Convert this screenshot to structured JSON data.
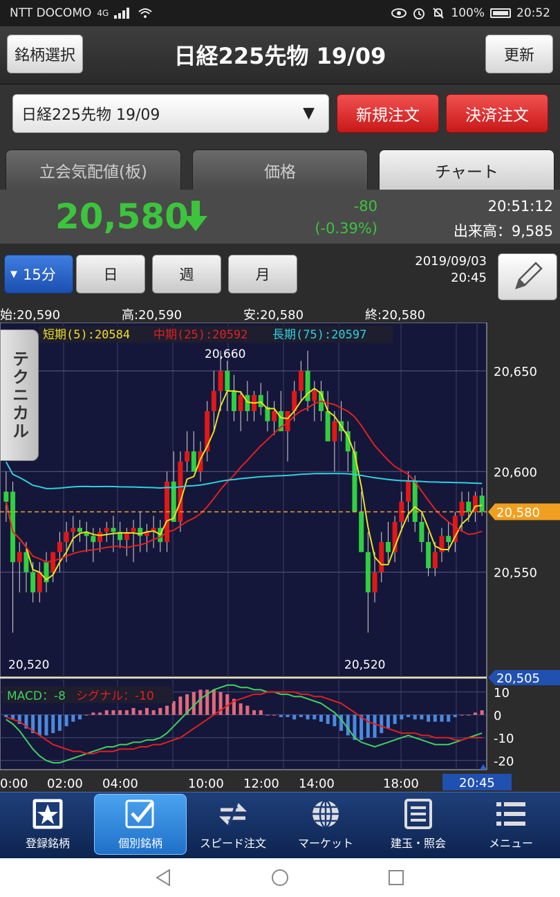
{
  "status": {
    "carrier": "NTT DOCOMO",
    "signal": "4G",
    "battery": "100%",
    "clock": "20:52"
  },
  "header": {
    "left_button": "銘柄選択",
    "title": "日経225先物 19/09",
    "right_button": "更新"
  },
  "selector": {
    "selected": "日経225先物 19/09",
    "new_order": "新規注文",
    "settle_order": "決済注文"
  },
  "tabs": [
    {
      "label": "立会気配値(板)",
      "active": false
    },
    {
      "label": "価格",
      "active": false
    },
    {
      "label": "チャート",
      "active": true
    }
  ],
  "quote": {
    "price": "20,580",
    "change": "-80",
    "change_pct": "(-0.39%)",
    "time": "20:51:12",
    "volume": "出来高：9,585",
    "color_down": "#3cc43c"
  },
  "periods": {
    "items": [
      {
        "label": "15分",
        "active": true
      },
      {
        "label": "日",
        "active": false
      },
      {
        "label": "週",
        "active": false
      },
      {
        "label": "月",
        "active": false
      }
    ],
    "date": "2019/09/03",
    "time": "20:45"
  },
  "ohlc": {
    "open": "始:20,590",
    "high": "高:20,590",
    "low": "安:20,580",
    "close": "終:20,580"
  },
  "technical_tab": "テクニカル",
  "chart_data": {
    "type": "candlestick",
    "ma_legend": [
      {
        "label": "短期(5):20584",
        "color": "#f0e020"
      },
      {
        "label": "中期(25):20592",
        "color": "#e02020"
      },
      {
        "label": "長期(75):20597",
        "color": "#30d0e0"
      }
    ],
    "ylim": [
      20498,
      20674
    ],
    "y_ticks": [
      "20,650",
      "20,600",
      "20,550"
    ],
    "y_tick_values": [
      20650,
      20600,
      20550
    ],
    "current_price_label": "20,580",
    "current_price": 20580,
    "lower_marker_label": "20,505",
    "lower_marker": 20505,
    "max_label": "20,660",
    "min_label_left": "20,520",
    "min_label_right": "20,520",
    "x_labels": [
      "0:00",
      "02:00",
      "04:00",
      "10:00",
      "12:00",
      "14:00",
      "18:00",
      "20:45"
    ],
    "candles": [
      [
        20590,
        20600,
        20575,
        20585
      ],
      [
        20590,
        20595,
        20520,
        20555
      ],
      [
        20555,
        20565,
        20540,
        20560
      ],
      [
        20560,
        20565,
        20540,
        20550
      ],
      [
        20550,
        20555,
        20535,
        20540
      ],
      [
        20540,
        20555,
        20535,
        20550
      ],
      [
        20555,
        20560,
        20540,
        20545
      ],
      [
        20550,
        20560,
        20545,
        20560
      ],
      [
        20560,
        20570,
        20550,
        20565
      ],
      [
        20565,
        20575,
        20555,
        20570
      ],
      [
        20570,
        20578,
        20560,
        20572
      ],
      [
        20572,
        20576,
        20565,
        20570
      ],
      [
        20570,
        20575,
        20560,
        20568
      ],
      [
        20568,
        20572,
        20555,
        20565
      ],
      [
        20565,
        20572,
        20560,
        20570
      ],
      [
        20570,
        20575,
        20565,
        20572
      ],
      [
        20572,
        20578,
        20560,
        20570
      ],
      [
        20570,
        20575,
        20562,
        20566
      ],
      [
        20566,
        20572,
        20558,
        20570
      ],
      [
        20570,
        20576,
        20555,
        20572
      ],
      [
        20572,
        20580,
        20560,
        20568
      ],
      [
        20568,
        20574,
        20560,
        20570
      ],
      [
        20570,
        20578,
        20562,
        20572
      ],
      [
        20572,
        20576,
        20560,
        20565
      ],
      [
        20565,
        20600,
        20560,
        20595
      ],
      [
        20595,
        20610,
        20590,
        20575
      ],
      [
        20575,
        20610,
        20570,
        20605
      ],
      [
        20605,
        20620,
        20600,
        20610
      ],
      [
        20610,
        20620,
        20600,
        20600
      ],
      [
        20600,
        20615,
        20595,
        20610
      ],
      [
        20610,
        20635,
        20605,
        20630
      ],
      [
        20630,
        20650,
        20620,
        20640
      ],
      [
        20640,
        20660,
        20630,
        20650
      ],
      [
        20650,
        20655,
        20630,
        20640
      ],
      [
        20640,
        20648,
        20625,
        20630
      ],
      [
        20630,
        20640,
        20620,
        20638
      ],
      [
        20638,
        20645,
        20625,
        20630
      ],
      [
        20630,
        20640,
        20625,
        20638
      ],
      [
        20638,
        20644,
        20628,
        20632
      ],
      [
        20632,
        20640,
        20620,
        20625
      ],
      [
        20625,
        20635,
        20618,
        20630
      ],
      [
        20630,
        20640,
        20625,
        20620
      ],
      [
        20620,
        20625,
        20605,
        20630
      ],
      [
        20630,
        20645,
        20625,
        20640
      ],
      [
        20640,
        20655,
        20635,
        20650
      ],
      [
        20650,
        20660,
        20630,
        20635
      ],
      [
        20635,
        20645,
        20625,
        20640
      ],
      [
        20640,
        20645,
        20625,
        20630
      ],
      [
        20630,
        20640,
        20620,
        20615
      ],
      [
        20615,
        20630,
        20600,
        20625
      ],
      [
        20625,
        20635,
        20615,
        20620
      ],
      [
        20620,
        20625,
        20600,
        20610
      ],
      [
        20610,
        20615,
        20590,
        20580
      ],
      [
        20580,
        20590,
        20560,
        20560
      ],
      [
        20560,
        20570,
        20520,
        20540
      ],
      [
        20540,
        20560,
        20535,
        20550
      ],
      [
        20550,
        20570,
        20545,
        20565
      ],
      [
        20565,
        20575,
        20555,
        20560
      ],
      [
        20560,
        20578,
        20555,
        20575
      ],
      [
        20575,
        20590,
        20570,
        20585
      ],
      [
        20585,
        20600,
        20575,
        20595
      ],
      [
        20595,
        20598,
        20570,
        20575
      ],
      [
        20575,
        20580,
        20560,
        20565
      ],
      [
        20565,
        20570,
        20548,
        20552
      ],
      [
        20552,
        20565,
        20548,
        20560
      ],
      [
        20560,
        20572,
        20555,
        20568
      ],
      [
        20568,
        20575,
        20560,
        20565
      ],
      [
        20565,
        20580,
        20560,
        20578
      ],
      [
        20578,
        20590,
        20570,
        20585
      ],
      [
        20585,
        20590,
        20575,
        20580
      ],
      [
        20580,
        20590,
        20575,
        20588
      ],
      [
        20588,
        20592,
        20578,
        20580
      ]
    ],
    "macd": {
      "legend_macd": "MACD：-8",
      "legend_signal": "シグナル：-10",
      "ylim": [
        -24,
        16
      ],
      "y_ticks": [
        "10",
        "0",
        "-10",
        "-20"
      ],
      "y_tick_values": [
        10,
        0,
        -10,
        -20
      ],
      "macd_color": "#40d060",
      "signal_color": "#e02020",
      "macd": [
        -2,
        -4,
        -7,
        -11,
        -15,
        -18,
        -20,
        -21,
        -21,
        -20,
        -19,
        -18,
        -17,
        -16,
        -15,
        -14,
        -14,
        -13,
        -13,
        -12,
        -12,
        -11,
        -11,
        -10,
        -8,
        -5,
        -2,
        1,
        4,
        7,
        9,
        11,
        12,
        13,
        13,
        12,
        12,
        11,
        11,
        10,
        10,
        9,
        9,
        8,
        8,
        7,
        6,
        5,
        3,
        1,
        -2,
        -6,
        -10,
        -12,
        -13,
        -14,
        -13,
        -12,
        -11,
        -10,
        -9,
        -10,
        -11,
        -12,
        -13,
        -13,
        -13,
        -12,
        -11,
        -10,
        -9,
        -8
      ],
      "signal": [
        -1,
        -2,
        -3,
        -5,
        -7,
        -9,
        -11,
        -13,
        -14,
        -15,
        -16,
        -16,
        -17,
        -17,
        -16,
        -16,
        -16,
        -15,
        -15,
        -15,
        -14,
        -14,
        -13,
        -13,
        -12,
        -11,
        -10,
        -8,
        -6,
        -4,
        -2,
        0,
        2,
        4,
        6,
        7,
        8,
        9,
        9,
        10,
        10,
        10,
        10,
        10,
        9,
        9,
        8,
        8,
        7,
        6,
        5,
        3,
        1,
        -1,
        -3,
        -4,
        -5,
        -6,
        -7,
        -8,
        -8,
        -8,
        -9,
        -9,
        -10,
        -10,
        -10,
        -11,
        -11,
        -10,
        -10,
        -10
      ]
    }
  },
  "bottom_nav": [
    {
      "label": "登録銘柄",
      "icon": "star-icon",
      "active": false
    },
    {
      "label": "個別銘柄",
      "icon": "checkbox-icon",
      "active": true
    },
    {
      "label": "スピード注文",
      "icon": "swap-arrows-icon",
      "active": false
    },
    {
      "label": "マーケット",
      "icon": "globe-icon",
      "active": false
    },
    {
      "label": "建玉・照会",
      "icon": "document-icon",
      "active": false
    },
    {
      "label": "メニュー",
      "icon": "menu-icon",
      "active": false
    }
  ]
}
